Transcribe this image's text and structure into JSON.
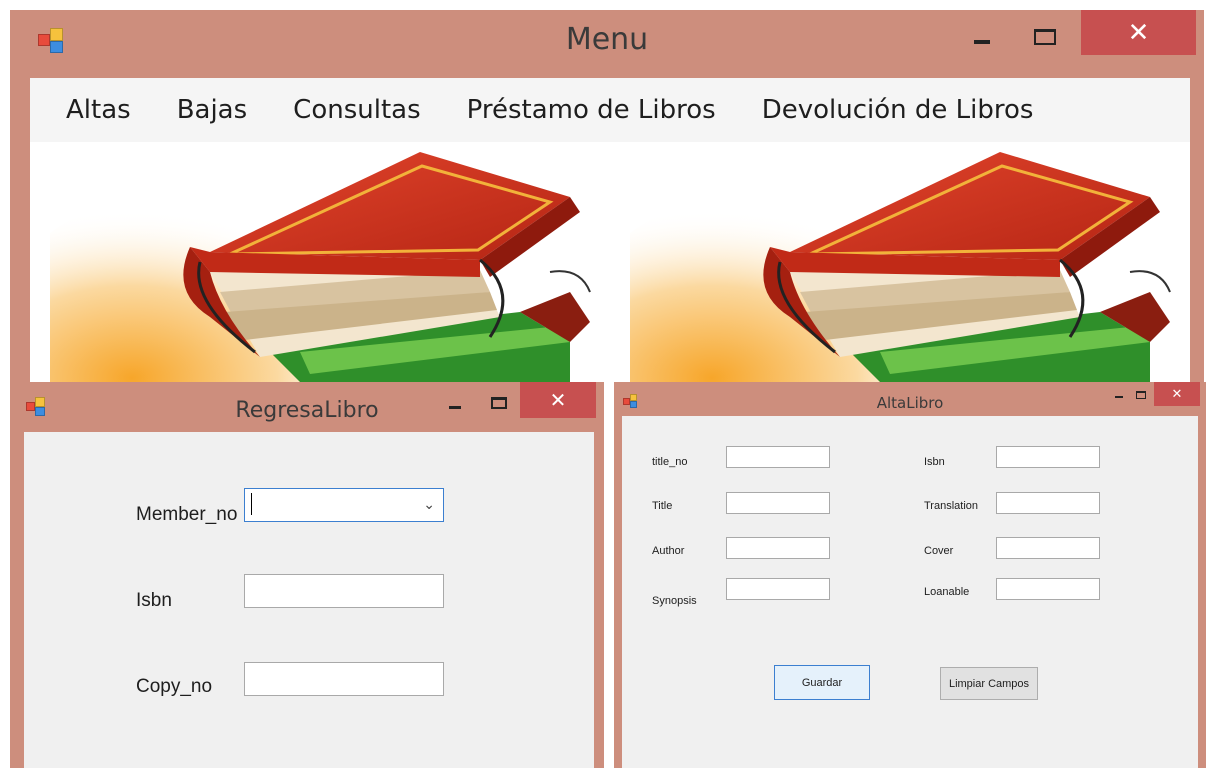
{
  "colors": {
    "window_frame": "#cd8e7d",
    "close_button": "#c75050",
    "client_bg": "#f0f0f0",
    "focus_border": "#3c7fd0"
  },
  "menu_window": {
    "title": "Menu",
    "menu_items": [
      "Altas",
      "Bajas",
      "Consultas",
      "Préstamo de Libros",
      "Devolución de Libros"
    ],
    "controls": {
      "minimize_icon": "minimize-icon",
      "maximize_icon": "maximize-icon",
      "close_icon": "close-icon",
      "close_glyph": "✕"
    }
  },
  "regresa_window": {
    "title": "RegresaLibro",
    "close_glyph": "✕",
    "fields": {
      "member_no": {
        "label": "Member_no",
        "value": ""
      },
      "isbn": {
        "label": "Isbn",
        "value": ""
      },
      "copy_no": {
        "label": "Copy_no",
        "value": ""
      }
    },
    "combo_chevron": "⌄"
  },
  "alta_window": {
    "title": "AltaLibro",
    "close_glyph": "✕",
    "left_fields": [
      {
        "label": "title_no",
        "value": ""
      },
      {
        "label": "Title",
        "value": ""
      },
      {
        "label": "Author",
        "value": ""
      },
      {
        "label": "Synopsis",
        "value": ""
      }
    ],
    "right_fields": [
      {
        "label": "Isbn",
        "value": ""
      },
      {
        "label": "Translation",
        "value": ""
      },
      {
        "label": "Cover",
        "value": ""
      },
      {
        "label": "Loanable",
        "value": ""
      }
    ],
    "buttons": {
      "save": "Guardar",
      "clear": "Limpiar Campos"
    }
  }
}
